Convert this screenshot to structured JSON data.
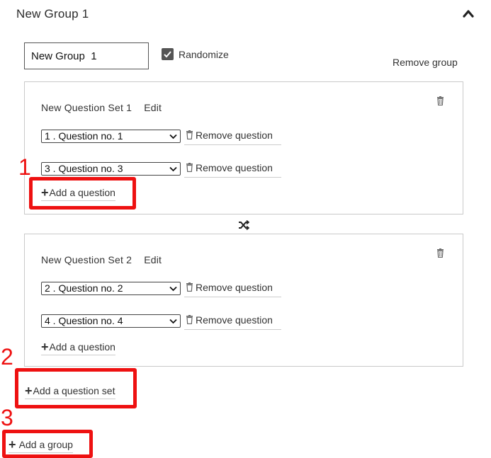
{
  "group": {
    "title": "New Group 1",
    "name_value": "New Group  1",
    "randomize_label": "Randomize",
    "randomize_checked": true,
    "remove_group_label": "Remove group"
  },
  "question_sets": [
    {
      "title": "New Question Set 1",
      "edit_label": "Edit",
      "questions": [
        {
          "selected": "1 . Question no. 1",
          "remove_label": "Remove question"
        },
        {
          "selected": "3 . Question no. 3",
          "remove_label": "Remove question"
        }
      ],
      "add_question_label": "Add a question"
    },
    {
      "title": "New Question Set 2",
      "edit_label": "Edit",
      "questions": [
        {
          "selected": "2 . Question no. 2",
          "remove_label": "Remove question"
        },
        {
          "selected": "4 . Question no. 4",
          "remove_label": "Remove question"
        }
      ],
      "add_question_label": "Add a question"
    }
  ],
  "add_question_set_label": "Add a question set",
  "add_group_label": "Add a group",
  "annotations": {
    "n1": "1",
    "n2": "2",
    "n3": "3"
  },
  "colors": {
    "highlight": "#ee1111",
    "border": "#c9c9c9",
    "text": "#333333"
  },
  "icons": [
    "chevron-up-icon",
    "checkbox-checked-icon",
    "trash-icon",
    "plus-icon",
    "shuffle-icon",
    "caret-down-icon"
  ]
}
